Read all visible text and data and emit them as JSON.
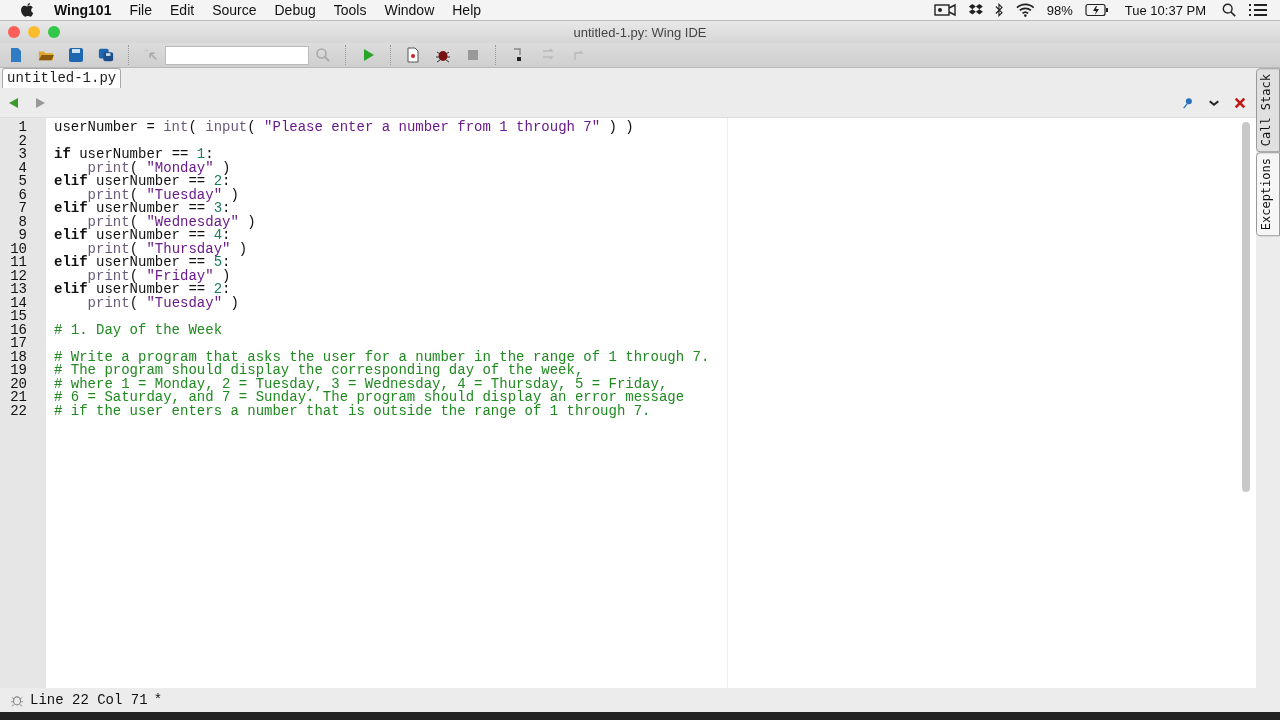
{
  "menubar": {
    "app": "Wing101",
    "menus": [
      "File",
      "Edit",
      "Source",
      "Debug",
      "Tools",
      "Window",
      "Help"
    ],
    "battery": "98%",
    "clock": "Tue 10:37 PM"
  },
  "window": {
    "title": "untitled-1.py: Wing IDE"
  },
  "tabs": [
    {
      "label": "untitled-1.py",
      "selected": true
    }
  ],
  "side_tabs": [
    {
      "label": "Call Stack",
      "selected": false
    },
    {
      "label": "Exceptions",
      "selected": true
    }
  ],
  "code": {
    "lines": [
      {
        "number": "1",
        "tokens": [
          {
            "kind": "plain",
            "text": "userNumber = "
          },
          {
            "kind": "builtin",
            "text": "int"
          },
          {
            "kind": "plain",
            "text": "( "
          },
          {
            "kind": "builtin",
            "text": "input"
          },
          {
            "kind": "plain",
            "text": "( "
          },
          {
            "kind": "string",
            "text": "\"Please enter a number from 1 through 7\""
          },
          {
            "kind": "plain",
            "text": " ) )"
          }
        ]
      },
      {
        "number": "2"
      },
      {
        "number": "3",
        "tokens": [
          {
            "kind": "keyword",
            "text": "if"
          },
          {
            "kind": "plain",
            "text": " userNumber == "
          },
          {
            "kind": "number",
            "text": "1"
          },
          {
            "kind": "plain",
            "text": ":"
          }
        ]
      },
      {
        "number": "4",
        "tokens": [
          {
            "kind": "builtin",
            "text": "    print"
          },
          {
            "kind": "plain",
            "text": "( "
          },
          {
            "kind": "string",
            "text": "\"Monday\""
          },
          {
            "kind": "plain",
            "text": " )"
          }
        ]
      },
      {
        "number": "5",
        "tokens": [
          {
            "kind": "keyword",
            "text": "elif"
          },
          {
            "kind": "plain",
            "text": " userNumber == "
          },
          {
            "kind": "number",
            "text": "2"
          },
          {
            "kind": "plain",
            "text": ":"
          }
        ]
      },
      {
        "number": "6",
        "tokens": [
          {
            "kind": "builtin",
            "text": "    print"
          },
          {
            "kind": "plain",
            "text": "( "
          },
          {
            "kind": "string",
            "text": "\"Tuesday\""
          },
          {
            "kind": "plain",
            "text": " )"
          }
        ]
      },
      {
        "number": "7",
        "tokens": [
          {
            "kind": "keyword",
            "text": "elif"
          },
          {
            "kind": "plain",
            "text": " userNumber == "
          },
          {
            "kind": "number",
            "text": "3"
          },
          {
            "kind": "plain",
            "text": ":"
          }
        ]
      },
      {
        "number": "8",
        "tokens": [
          {
            "kind": "builtin",
            "text": "    print"
          },
          {
            "kind": "plain",
            "text": "( "
          },
          {
            "kind": "string",
            "text": "\"Wednesday\""
          },
          {
            "kind": "plain",
            "text": " )"
          }
        ]
      },
      {
        "number": "9",
        "tokens": [
          {
            "kind": "keyword",
            "text": "elif"
          },
          {
            "kind": "plain",
            "text": " userNumber == "
          },
          {
            "kind": "number",
            "text": "4"
          },
          {
            "kind": "plain",
            "text": ":"
          }
        ]
      },
      {
        "number": "10",
        "tokens": [
          {
            "kind": "builtin",
            "text": "    print"
          },
          {
            "kind": "plain",
            "text": "( "
          },
          {
            "kind": "string",
            "text": "\"Thursday\""
          },
          {
            "kind": "plain",
            "text": " )"
          }
        ]
      },
      {
        "number": "11",
        "tokens": [
          {
            "kind": "keyword",
            "text": "elif"
          },
          {
            "kind": "plain",
            "text": " userNumber == "
          },
          {
            "kind": "number",
            "text": "5"
          },
          {
            "kind": "plain",
            "text": ":"
          }
        ]
      },
      {
        "number": "12",
        "tokens": [
          {
            "kind": "builtin",
            "text": "    print"
          },
          {
            "kind": "plain",
            "text": "( "
          },
          {
            "kind": "string",
            "text": "\"Friday\""
          },
          {
            "kind": "plain",
            "text": " )"
          }
        ]
      },
      {
        "number": "13",
        "tokens": [
          {
            "kind": "keyword",
            "text": "elif"
          },
          {
            "kind": "plain",
            "text": " userNumber == "
          },
          {
            "kind": "number",
            "text": "2"
          },
          {
            "kind": "plain",
            "text": ":"
          }
        ]
      },
      {
        "number": "14",
        "tokens": [
          {
            "kind": "builtin",
            "text": "    print"
          },
          {
            "kind": "plain",
            "text": "( "
          },
          {
            "kind": "string",
            "text": "\"Tuesday\""
          },
          {
            "kind": "plain",
            "text": " )"
          }
        ]
      },
      {
        "number": "15"
      },
      {
        "number": "16",
        "tokens": [
          {
            "kind": "comment",
            "text": "# 1. Day of the Week"
          }
        ]
      },
      {
        "number": "17"
      },
      {
        "number": "18",
        "tokens": [
          {
            "kind": "comment",
            "text": "# Write a program that asks the user for a number in the range of 1 through 7."
          }
        ]
      },
      {
        "number": "19",
        "tokens": [
          {
            "kind": "comment",
            "text": "# The program should display the corresponding day of the week,"
          }
        ]
      },
      {
        "number": "20",
        "tokens": [
          {
            "kind": "comment",
            "text": "# where 1 = Monday, 2 = Tuesday, 3 = Wednesday, 4 = Thursday, 5 = Friday,"
          }
        ]
      },
      {
        "number": "21",
        "tokens": [
          {
            "kind": "comment",
            "text": "# 6 = Saturday, and 7 = Sunday. The program should display an error message"
          }
        ]
      },
      {
        "number": "22",
        "tokens": [
          {
            "kind": "comment",
            "text": "# if the user enters a number that is outside the range of 1 through 7."
          }
        ]
      }
    ]
  },
  "status_bar": {
    "position": "Line 22 Col 71",
    "modified": "*"
  }
}
